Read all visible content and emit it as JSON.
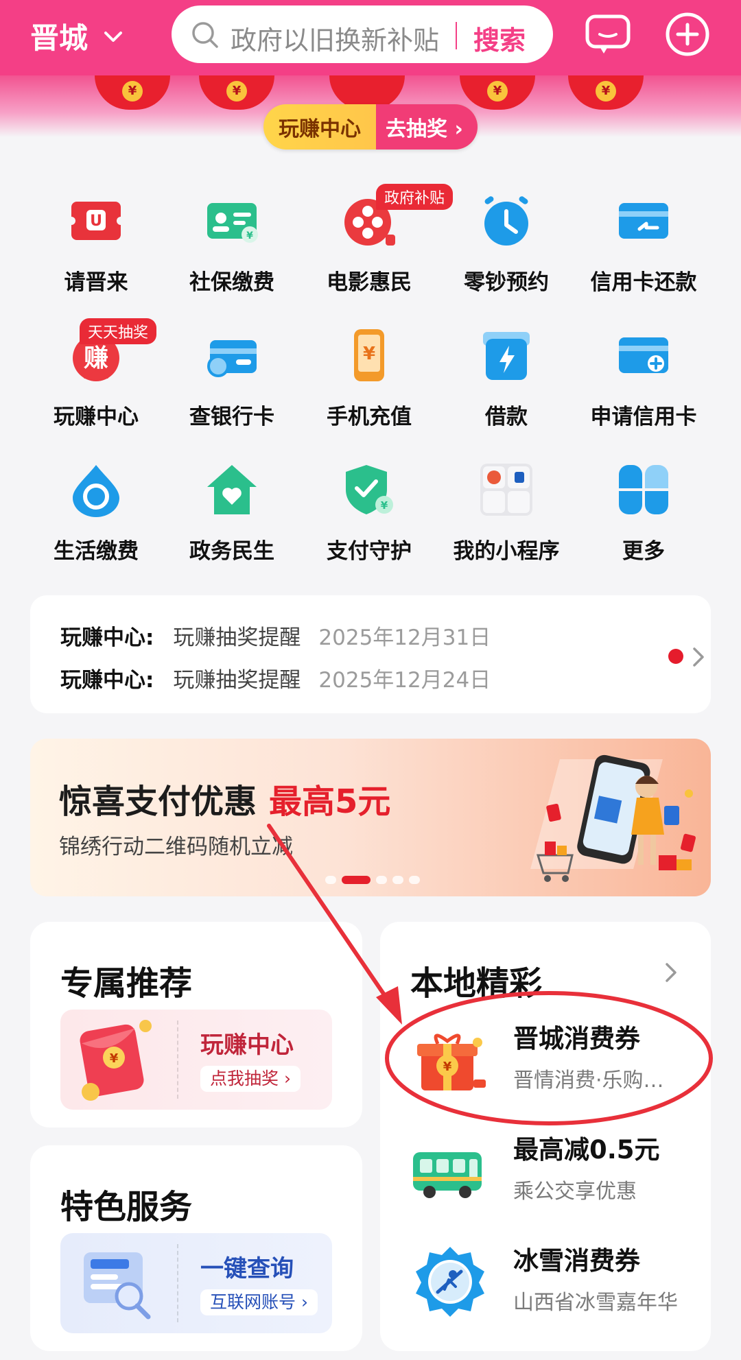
{
  "header": {
    "city": "晋城",
    "search_placeholder": "政府以旧换新补贴",
    "search_button": "搜索"
  },
  "banner": {
    "pill_left": "玩赚中心",
    "pill_right": "去抽奖 ›"
  },
  "grid": [
    {
      "label": "请晋来",
      "icon": "coupon-u-icon"
    },
    {
      "label": "社保缴费",
      "icon": "id-card-icon"
    },
    {
      "label": "电影惠民",
      "icon": "film-reel-icon",
      "badge": "政府补贴"
    },
    {
      "label": "零钞预约",
      "icon": "alarm-clock-icon"
    },
    {
      "label": "信用卡还款",
      "icon": "card-return-icon"
    },
    {
      "label": "玩赚中心",
      "icon": "earn-icon",
      "badge": "天天抽奖"
    },
    {
      "label": "查银行卡",
      "icon": "bank-card-search-icon"
    },
    {
      "label": "手机充值",
      "icon": "phone-recharge-icon"
    },
    {
      "label": "借款",
      "icon": "lightning-loan-icon"
    },
    {
      "label": "申请信用卡",
      "icon": "card-add-icon"
    },
    {
      "label": "生活缴费",
      "icon": "water-drop-icon"
    },
    {
      "label": "政务民生",
      "icon": "house-heart-icon"
    },
    {
      "label": "支付守护",
      "icon": "shield-check-icon"
    },
    {
      "label": "我的小程序",
      "icon": "mini-program-icon"
    },
    {
      "label": "更多",
      "icon": "four-petal-icon"
    }
  ],
  "notices": [
    {
      "key": "玩赚中心:",
      "text": "玩赚抽奖提醒",
      "date": "2025年12月31日"
    },
    {
      "key": "玩赚中心:",
      "text": "玩赚抽奖提醒",
      "date": "2025年12月24日"
    }
  ],
  "promo": {
    "title": "惊喜支付优惠",
    "highlight": "最高5元",
    "subtitle": "锦绣行动二维码随机立减"
  },
  "recommend": {
    "title": "专属推荐",
    "card_title": "玩赚中心",
    "card_sub": "点我抽奖 ›"
  },
  "services": {
    "title": "特色服务",
    "card_title": "一键查询",
    "card_sub": "互联网账号 ›"
  },
  "local": {
    "title": "本地精彩",
    "items": [
      {
        "title": "晋城消费券",
        "sub": "晋情消费·乐购晋城"
      },
      {
        "title": "最高减0.5元",
        "sub": "乘公交享优惠"
      },
      {
        "title": "冰雪消费券",
        "sub": "山西省冰雪嘉年华"
      }
    ]
  },
  "colors": {
    "brand": "#f43f86",
    "red": "#e5202c",
    "blue": "#1e9be8",
    "annotation": "#e8303a"
  }
}
